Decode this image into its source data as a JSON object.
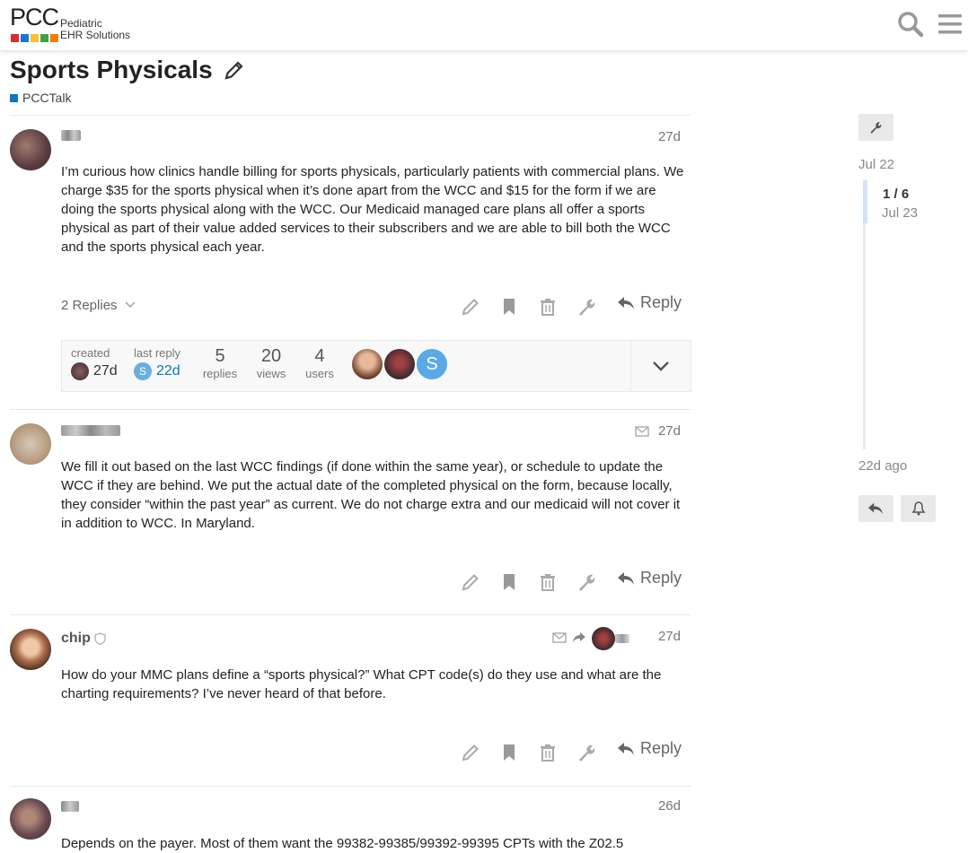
{
  "header": {
    "logo_main": "PCC",
    "logo_line1": "Pediatric",
    "logo_line2": "EHR Solutions",
    "logo_colors": [
      "#d32f2f",
      "#1976d2",
      "#fbc02d",
      "#43a047",
      "#f57c00",
      "#8e24aa"
    ]
  },
  "topic": {
    "title": "Sports Physicals",
    "category": "PCCTalk",
    "category_color": "#0e76bd"
  },
  "posts": [
    {
      "username": "",
      "date": "27d",
      "body": "I’m curious how clinics handle billing for sports physicals, particularly patients with commercial plans. We charge $35 for the sports physical when it’s done apart from the WCC and $15 for the form if we are doing the sports physical along with the WCC. Our Medicaid managed care plans all offer a sports physical as part of their value added services to their subscribers and we are able to bill both the WCC and the sports physical each year.",
      "replies_toggle": "2 Replies",
      "reply_label": "Reply"
    },
    {
      "username": "",
      "date": "27d",
      "body": "We fill it out based on the last WCC findings (if done within the same year), or schedule to update the WCC if they are behind. We put the actual date of the completed physical on the form, because locally, they consider “within the past year” as current. We do not charge extra and our medicaid will not cover it in addition to WCC. In Maryland.",
      "reply_label": "Reply"
    },
    {
      "username": "chip",
      "date": "27d",
      "body": "How do your MMC plans define a “sports physical?” What CPT code(s) do they use and what are the charting requirements? I’ve never heard of that before.",
      "reply_label": "Reply"
    },
    {
      "username": "",
      "date": "26d",
      "body": "Depends on the payer. Most of them want the 99382-99385/99392-99395 CPTs with the Z02.5"
    }
  ],
  "topic_map": {
    "created_label": "created",
    "created_value": "27d",
    "last_reply_label": "last reply",
    "last_reply_value": "22d",
    "last_reply_initial": "S",
    "replies_num": "5",
    "replies_label": "replies",
    "views_num": "20",
    "views_label": "views",
    "users_num": "4",
    "users_label": "users",
    "user_initial": "S"
  },
  "timeline": {
    "start_date": "Jul 22",
    "progress": "1 / 6",
    "progress_date": "Jul 23",
    "end_date": "22d ago"
  },
  "icons": [
    "search-icon",
    "hamburger-menu-icon",
    "pencil-icon",
    "bookmark-icon",
    "trash-icon",
    "wrench-icon",
    "reply-icon",
    "chevron-down-icon",
    "envelope-icon",
    "shield-icon",
    "bell-icon"
  ]
}
